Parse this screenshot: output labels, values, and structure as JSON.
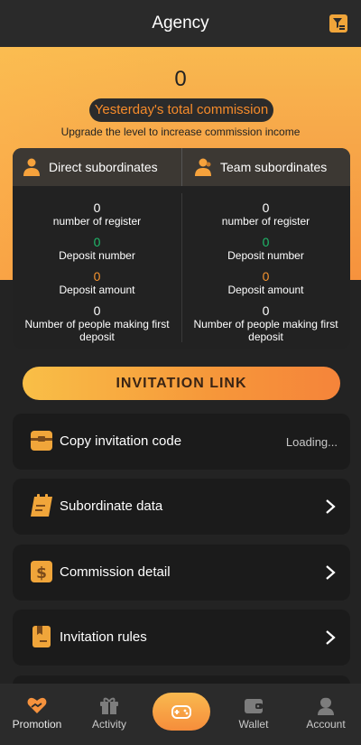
{
  "header": {
    "title": "Agency",
    "filter_icon": "filter-icon"
  },
  "hero": {
    "total_commission": "0",
    "commission_label": "Yesterday's total commission",
    "hint": "Upgrade the level to increase commission income"
  },
  "stats": {
    "direct": {
      "title": "Direct subordinates",
      "icon": "user-icon",
      "register_value": "0",
      "register_label": "number of register",
      "deposit_number_value": "0",
      "deposit_number_label": "Deposit number",
      "deposit_amount_value": "0",
      "deposit_amount_label": "Deposit amount",
      "first_deposit_value": "0",
      "first_deposit_label": "Number of people making first deposit"
    },
    "team": {
      "title": "Team subordinates",
      "icon": "team-icon",
      "register_value": "0",
      "register_label": "number of register",
      "deposit_number_value": "0",
      "deposit_number_label": "Deposit number",
      "deposit_amount_value": "0",
      "deposit_amount_label": "Deposit amount",
      "first_deposit_value": "0",
      "first_deposit_label": "Number of people making first deposit"
    }
  },
  "invite_button": "INVITATION LINK",
  "menu": [
    {
      "label": "Copy invitation code",
      "right_text": "Loading...",
      "icon": "gift-box-icon"
    },
    {
      "label": "Subordinate data",
      "icon": "calendar-icon"
    },
    {
      "label": "Commission detail",
      "icon": "dollar-icon"
    },
    {
      "label": "Invitation rules",
      "icon": "book-icon"
    }
  ],
  "bottom_nav": [
    {
      "label": "Promotion",
      "icon": "heart-hand-icon",
      "active": true
    },
    {
      "label": "Activity",
      "icon": "gift-icon"
    },
    {
      "label": "",
      "icon": "gamepad-icon"
    },
    {
      "label": "Wallet",
      "icon": "wallet-icon"
    },
    {
      "label": "Account",
      "icon": "avatar-icon"
    }
  ],
  "colors": {
    "accent": "#f6923d",
    "green": "#1fb86a",
    "orange_text": "#f5932f"
  }
}
